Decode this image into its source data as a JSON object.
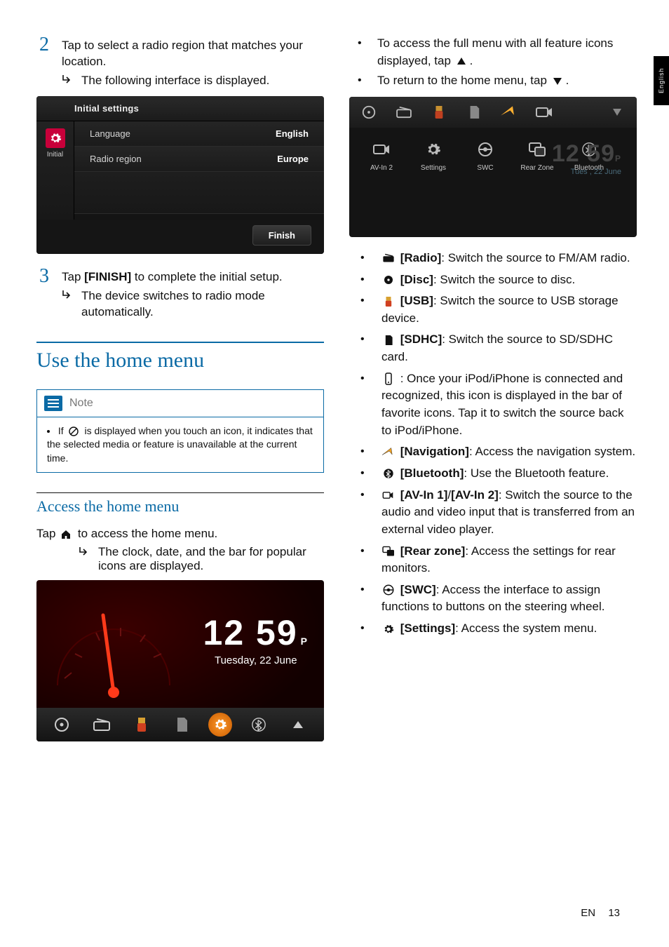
{
  "side_tab": "English",
  "left": {
    "step2_num": "2",
    "step2_text": "Tap to select a radio region that matches your location.",
    "step2_sub": "The following interface is displayed.",
    "fig1": {
      "title": "Initial settings",
      "side_label": "Initial",
      "rows": [
        {
          "label": "Language",
          "value": "English"
        },
        {
          "label": "Radio region",
          "value": "Europe"
        }
      ],
      "button": "Finish"
    },
    "step3_num": "3",
    "step3_text_pre": "Tap ",
    "step3_text_b": "[FINISH]",
    "step3_text_post": " to complete the initial setup.",
    "step3_sub": "The device switches to radio mode automatically.",
    "h2": "Use the home menu",
    "note_title": "Note",
    "note_body_pre": "If ",
    "note_body_post": " is displayed when you touch an icon, it indicates that the selected media or feature is unavailable at the current time.",
    "h3": "Access the home menu",
    "access_line_pre": "Tap ",
    "access_line_post": " to access the home menu.",
    "access_sub": "The clock, date, and the bar for popular icons are displayed.",
    "fig2": {
      "time": "12 59",
      "pm": "P",
      "date": "Tuesday, 22 June"
    }
  },
  "right": {
    "bullet1_pre": "To access the full menu with all feature icons displayed, tap ",
    "bullet1_post": ".",
    "bullet2_pre": "To return to the home menu, tap ",
    "bullet2_post": ".",
    "fig3": {
      "labels": [
        "AV-In 2",
        "Settings",
        "SWC",
        "Rear Zone",
        "Bluetooth"
      ],
      "time": "12 59",
      "pm": "P",
      "date": "Tues    , 22 June"
    },
    "items": {
      "radio": {
        "b": "[Radio]",
        "t": ": Switch the source to FM/AM radio."
      },
      "disc": {
        "b": "[Disc]",
        "t": ": Switch the source to disc."
      },
      "usb": {
        "b": "[USB]",
        "t": ": Switch the source to USB storage device."
      },
      "sdhc": {
        "b": "[SDHC]",
        "t": ": Switch the source to SD/SDHC card."
      },
      "ipod": {
        "t": " : Once your iPod/iPhone is connected and recognized, this icon is displayed in the bar of favorite icons. Tap it to switch the source back to iPod/iPhone."
      },
      "nav": {
        "b": "[Navigation]",
        "t": ": Access the navigation system."
      },
      "bt": {
        "b": "[Bluetooth]",
        "t": ": Use the Bluetooth feature."
      },
      "avin": {
        "b": "[AV-In 1]",
        "sep": "/",
        "b2": "[AV-In 2]",
        "t": ": Switch the source to the audio and video input that is transferred from an external video player."
      },
      "rear": {
        "b": "[Rear zone]",
        "t": ": Access the settings for rear monitors."
      },
      "swc": {
        "b": "[SWC]",
        "t": ": Access the interface to assign functions to buttons on the steering wheel."
      },
      "settings": {
        "b": "[Settings]",
        "t": ": Access the system menu."
      }
    }
  },
  "footer": {
    "lang": "EN",
    "page": "13"
  }
}
